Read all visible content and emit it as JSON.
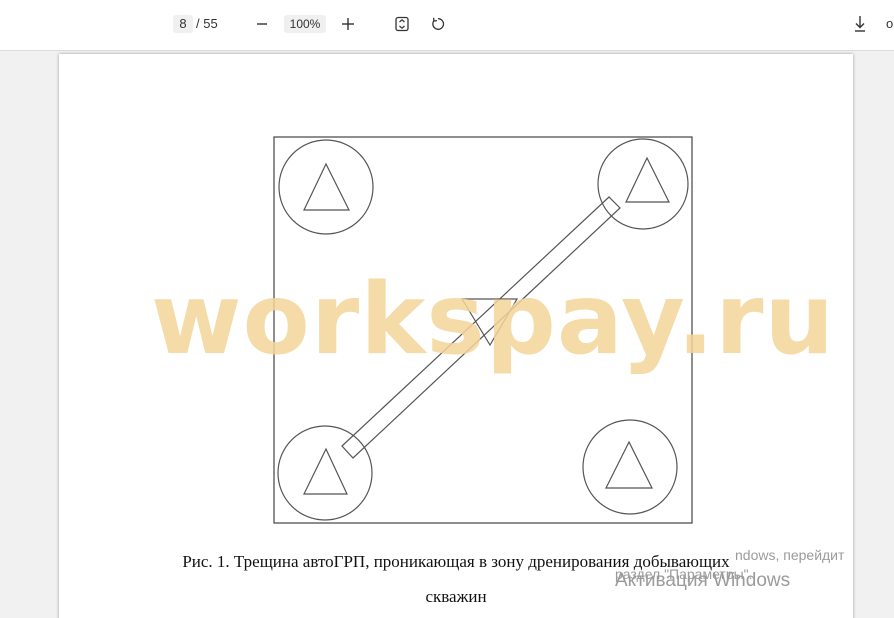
{
  "toolbar": {
    "page_current": "8",
    "page_total": "/ 55",
    "zoom_value": "100%",
    "cut_label": "o"
  },
  "document": {
    "watermark": "workspay.ru",
    "caption_line1": "Рис. 1. Трещина автоГРП, проникающая в зону дренирования добывающих",
    "caption_line2": "скважин"
  },
  "activation": {
    "title": "Активация Windows",
    "line1": "ndows, перейдит",
    "line2": "раздел \"Параметры\"."
  },
  "colors": {
    "watermark": "#f3d59a",
    "toolbar_bg": "#ffffff",
    "viewer_bg": "#f1f1f1"
  }
}
